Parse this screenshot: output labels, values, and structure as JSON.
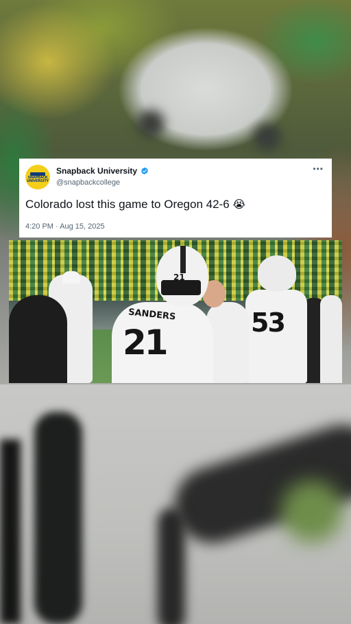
{
  "tweet": {
    "display_name": "Snapback University",
    "handle": "@snapbackcollege",
    "text": "Colorado lost this game to Oregon 42-6",
    "emoji": "😭",
    "timestamp": "4:20 PM · Aug 15, 2025",
    "more_label": "•••",
    "avatar_logo_top": "SNAPBACK",
    "avatar_logo_bottom": "UNIVERSITY"
  },
  "photo": {
    "jersey_21_name": "SANDERS",
    "jersey_21_number": "21",
    "helmet_21_number": "21",
    "jersey_53_number": "53"
  },
  "colors": {
    "verified_blue": "#1d9bf0",
    "avatar_yellow": "#f4cf1a",
    "text_primary": "#0f1419",
    "text_secondary": "#536471"
  }
}
